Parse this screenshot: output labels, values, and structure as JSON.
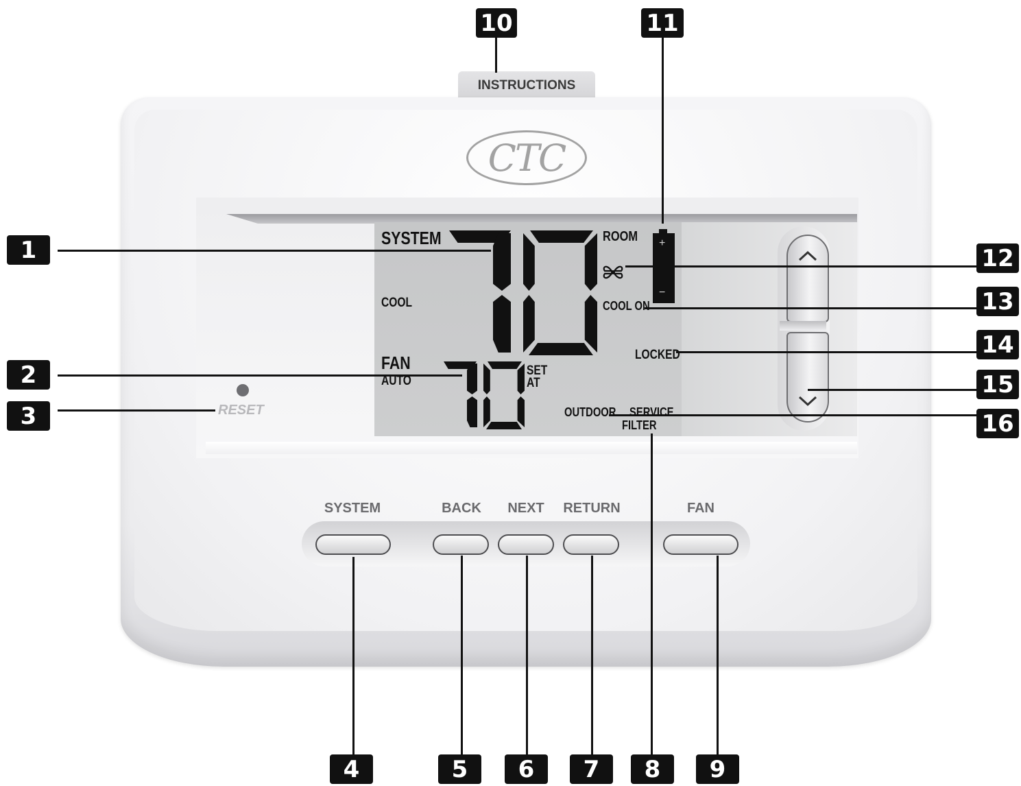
{
  "instructions_tab": "INSTRUCTIONS",
  "logo": "CTC",
  "lcd": {
    "system": "SYSTEM",
    "cool": "COOL",
    "fan": "FAN",
    "auto": "AUTO",
    "room": "ROOM",
    "room_temp": "70",
    "set_temp": "70",
    "set": "SET",
    "at": "AT",
    "cool_on": "COOL ON",
    "locked": "LOCKED",
    "outdoor": "OUTDOOR",
    "service": "SERVICE",
    "filter": "FILTER",
    "battery_plus": "+",
    "battery_minus": "−"
  },
  "reset": "RESET",
  "buttons": {
    "system": "SYSTEM",
    "back": "BACK",
    "next": "NEXT",
    "return": "RETURN",
    "fan": "FAN"
  },
  "callouts": {
    "c1": "1",
    "c2": "2",
    "c3": "3",
    "c4": "4",
    "c5": "5",
    "c6": "6",
    "c7": "7",
    "c8": "8",
    "c9": "9",
    "c10": "10",
    "c11": "11",
    "c12": "12",
    "c13": "13",
    "c14": "14",
    "c15": "15",
    "c16": "16"
  },
  "colors": {
    "lcd": "#c8c9ca",
    "callout": "#111111",
    "body": "#f2f2f4"
  }
}
